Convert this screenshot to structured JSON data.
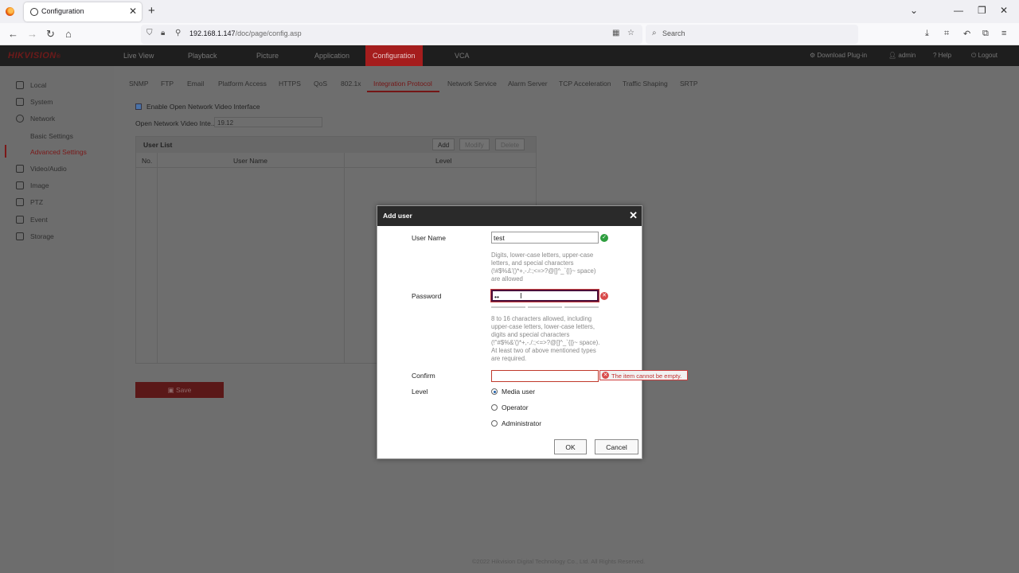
{
  "browser": {
    "tab_title": "Configuration",
    "tab_close": "✕",
    "new_tab": "+",
    "url_host": "192.168.1.147",
    "url_path": "/doc/page/config.asp",
    "search_placeholder": "Search",
    "window_minimize": "—",
    "window_restore": "❐",
    "window_close": "✕",
    "tabs_dropdown": "⌄"
  },
  "app": {
    "logo": "HIKVISION",
    "logo_mark": "®",
    "menu": [
      "Live View",
      "Playback",
      "Picture",
      "Application",
      "Configuration",
      "VCA"
    ],
    "active_menu": "Configuration",
    "header_right": {
      "download": "Download Plug-in",
      "user": "admin",
      "help": "Help",
      "logout": "Logout"
    }
  },
  "sidebar": {
    "items": [
      "Local",
      "System",
      "Network",
      "Video/Audio",
      "Image",
      "PTZ",
      "Event",
      "Storage"
    ],
    "network_sub": [
      "Basic Settings",
      "Advanced Settings"
    ],
    "active_sub": "Advanced Settings"
  },
  "subtabs": {
    "items": [
      "SNMP",
      "FTP",
      "Email",
      "Platform Access",
      "HTTPS",
      "QoS",
      "802.1x",
      "Integration Protocol",
      "Network Service",
      "Alarm Server",
      "TCP Acceleration",
      "Traffic Shaping",
      "SRTP"
    ],
    "active": "Integration Protocol"
  },
  "onvif": {
    "enable_label": "Enable Open Network Video Interface",
    "enabled": true,
    "version_label": "Open Network Video Inte...",
    "version_value": "19.12"
  },
  "user_list": {
    "title": "User List",
    "buttons": {
      "add": "Add",
      "modify": "Modify",
      "delete": "Delete"
    },
    "columns": [
      "No.",
      "User Name",
      "Level"
    ]
  },
  "save_label": "Save",
  "footer": "©2022 Hikvision Digital Technology Co., Ltd. All Rights Reserved.",
  "dialog": {
    "title": "Add user",
    "close": "✕",
    "username_label": "User Name",
    "username_value": "test",
    "username_hint": "Digits, lower-case letters, upper-case letters, and special characters (!#$%&'()*+,-./:;<=>?@[]^_`{|}~ space) are allowed",
    "password_label": "Password",
    "password_value": "••",
    "password_hint": "8 to 16 characters allowed, including upper-case letters, lower-case letters, digits and special characters (!\"#$%&'()*+,-./:;<=>?@[]^_`{|}~ space). At least two of above mentioned types are required.",
    "confirm_label": "Confirm",
    "confirm_value": "",
    "confirm_error": "The item cannot be empty.",
    "level_label": "Level",
    "levels": [
      "Media user",
      "Operator",
      "Administrator"
    ],
    "selected_level": "Media user",
    "ok": "OK",
    "cancel": "Cancel"
  }
}
